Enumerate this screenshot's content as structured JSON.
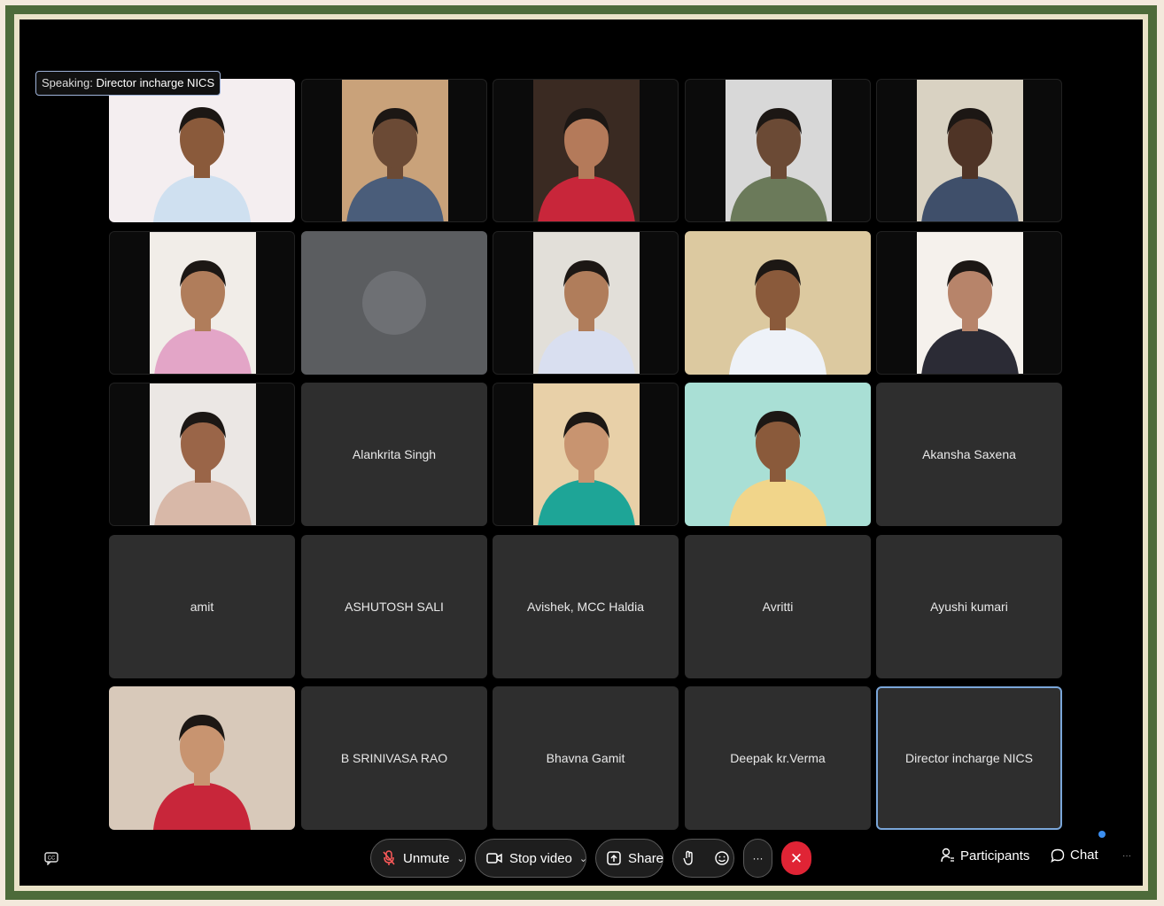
{
  "speaking": {
    "label": "Speaking:",
    "name": "Director incharge NICS"
  },
  "participants": [
    {
      "name": "",
      "type": "video",
      "bg": "#f4eef0",
      "skin": "#8a5a3b",
      "shirt": "#cfe0f0"
    },
    {
      "name": "",
      "type": "video",
      "bg": "#c9a27a",
      "skin": "#6b4a35",
      "shirt": "#4a5d7a"
    },
    {
      "name": "",
      "type": "video",
      "bg": "#3a2a22",
      "skin": "#b47a5a",
      "shirt": "#c8263a"
    },
    {
      "name": "",
      "type": "video",
      "bg": "#d8d8d8",
      "skin": "#6b4a35",
      "shirt": "#6b7a5a"
    },
    {
      "name": "",
      "type": "video",
      "bg": "#d9d2c2",
      "skin": "#4f3426",
      "shirt": "#3f4f6a"
    },
    {
      "name": "",
      "type": "video",
      "bg": "#f1ede8",
      "skin": "#b07d5b",
      "shirt": "#e3a5c7"
    },
    {
      "name": "",
      "type": "avatar",
      "bg": "#5b5d60"
    },
    {
      "name": "",
      "type": "video",
      "bg": "#e2dfd9",
      "skin": "#b07d5b",
      "shirt": "#d9dff0"
    },
    {
      "name": "",
      "type": "video",
      "bg": "#dcc9a0",
      "skin": "#8a5a3b",
      "shirt": "#eef2f8"
    },
    {
      "name": "",
      "type": "video",
      "bg": "#f5f1ec",
      "skin": "#b7846a",
      "shirt": "#2b2b35"
    },
    {
      "name": "",
      "type": "video",
      "bg": "#ebe7e4",
      "skin": "#9a6548",
      "shirt": "#d8b8a8"
    },
    {
      "name": "Alankrita Singh",
      "type": "name"
    },
    {
      "name": "",
      "type": "video",
      "bg": "#e8d0a8",
      "skin": "#c89470",
      "shirt": "#1ea597"
    },
    {
      "name": "",
      "type": "video",
      "bg": "#a9dfd5",
      "skin": "#8a5a3b",
      "shirt": "#f1d58a"
    },
    {
      "name": "Akansha Saxena",
      "type": "name"
    },
    {
      "name": "amit",
      "type": "name"
    },
    {
      "name": "ASHUTOSH SALI",
      "type": "name"
    },
    {
      "name": "Avishek, MCC Haldia",
      "type": "name"
    },
    {
      "name": "Avritti",
      "type": "name"
    },
    {
      "name": "Ayushi kumari",
      "type": "name"
    },
    {
      "name": "",
      "type": "video",
      "bg": "#d8c9ba",
      "skin": "#c89470",
      "shirt": "#c8263a"
    },
    {
      "name": "B SRINIVASA RAO",
      "type": "name"
    },
    {
      "name": "Bhavna Gamit",
      "type": "name"
    },
    {
      "name": "Deepak kr.Verma",
      "type": "name"
    },
    {
      "name": "Director incharge NICS",
      "type": "name",
      "active": true
    }
  ],
  "toolbar": {
    "unmute": "Unmute",
    "stop_video": "Stop video",
    "share": "Share",
    "participants": "Participants",
    "chat": "Chat",
    "more": "···",
    "end": "✕"
  },
  "colors": {
    "accent": "#3b8ef0",
    "end": "#e02435",
    "active_border": "#7aa6d9"
  }
}
